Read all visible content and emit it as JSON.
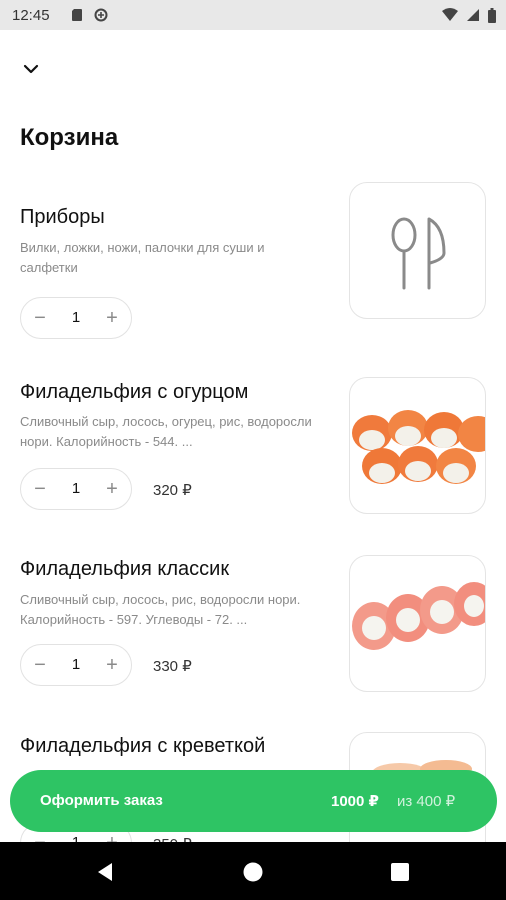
{
  "status_bar": {
    "time": "12:45"
  },
  "header": {
    "title": "Корзина"
  },
  "items": [
    {
      "name": "Приборы",
      "description": "Вилки, ложки, ножи, палочки для суши и салфетки",
      "quantity": "1",
      "price": ""
    },
    {
      "name": "Филадельфия с огурцом",
      "description": "Сливочный сыр, лосось, огурец, рис, водоросли нори. Калорийность - 544. ...",
      "quantity": "1",
      "price": "320 ₽"
    },
    {
      "name": "Филадельфия классик",
      "description": "Сливочный сыр, лосось, рис, водоросли нори. Калорийность - 597. Углеводы - 72. ...",
      "quantity": "1",
      "price": "330 ₽"
    },
    {
      "name": "Филадельфия с креветкой",
      "quantity": "1",
      "price": "350 ₽"
    }
  ],
  "stepper": {
    "minus": "−",
    "plus": "+"
  },
  "order": {
    "label": "Оформить заказ",
    "total": "1000 ₽",
    "minimum": "из 400 ₽"
  },
  "colors": {
    "accent": "#2ec464",
    "status_bar": "#e8e8e8",
    "nav_bar": "#000000"
  }
}
